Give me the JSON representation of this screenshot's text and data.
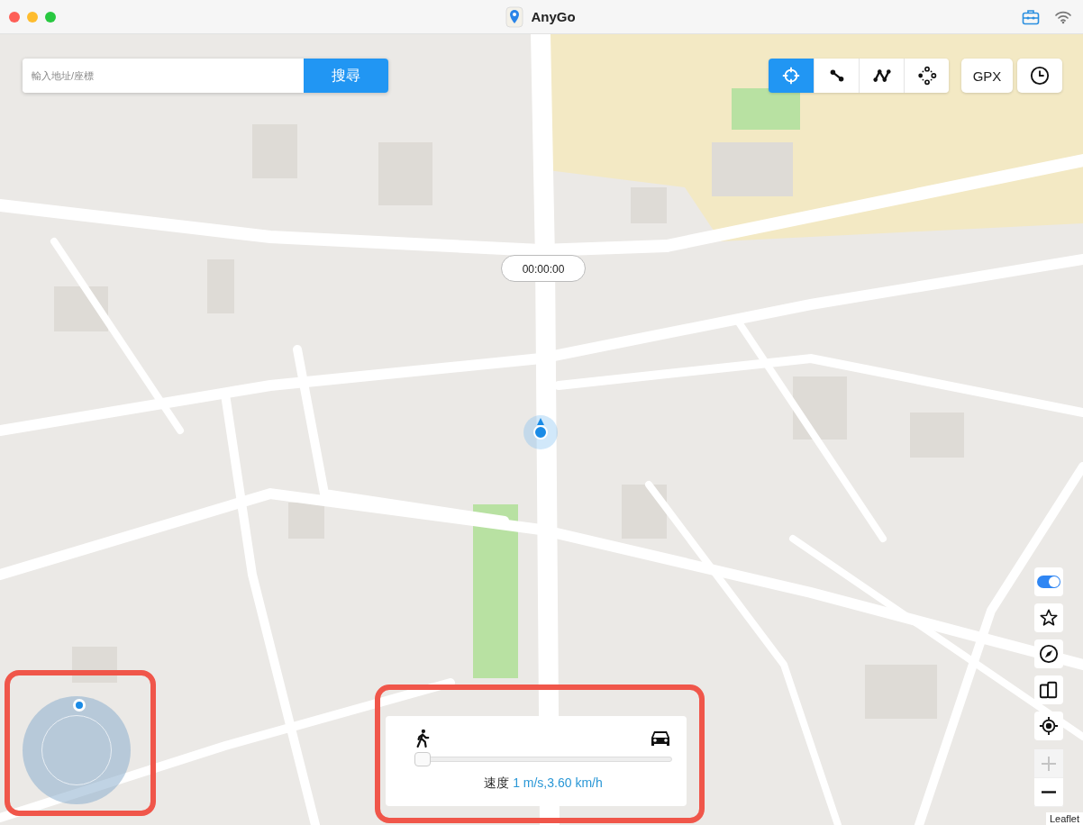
{
  "window": {
    "title": "AnyGo"
  },
  "search": {
    "placeholder": "輸入地址/座標",
    "button": "搜尋"
  },
  "modes": [
    {
      "kind": "teleport",
      "selected": true
    },
    {
      "kind": "two-spot",
      "selected": false
    },
    {
      "kind": "multi-spot",
      "selected": false
    },
    {
      "kind": "jump",
      "selected": false
    }
  ],
  "gpx_button": "GPX",
  "timer": "00:00:00",
  "toggle": {
    "on": true
  },
  "side_tools": [
    {
      "kind": "star"
    },
    {
      "kind": "compass"
    },
    {
      "kind": "devices"
    },
    {
      "kind": "locate"
    }
  ],
  "zoom": [
    {
      "kind": "in",
      "disabled": true
    },
    {
      "kind": "out",
      "disabled": false
    }
  ],
  "speed": {
    "level": 0,
    "label": "速度",
    "reading": "1 m/s,3.60 km/h"
  },
  "attribution": "Leaflet"
}
